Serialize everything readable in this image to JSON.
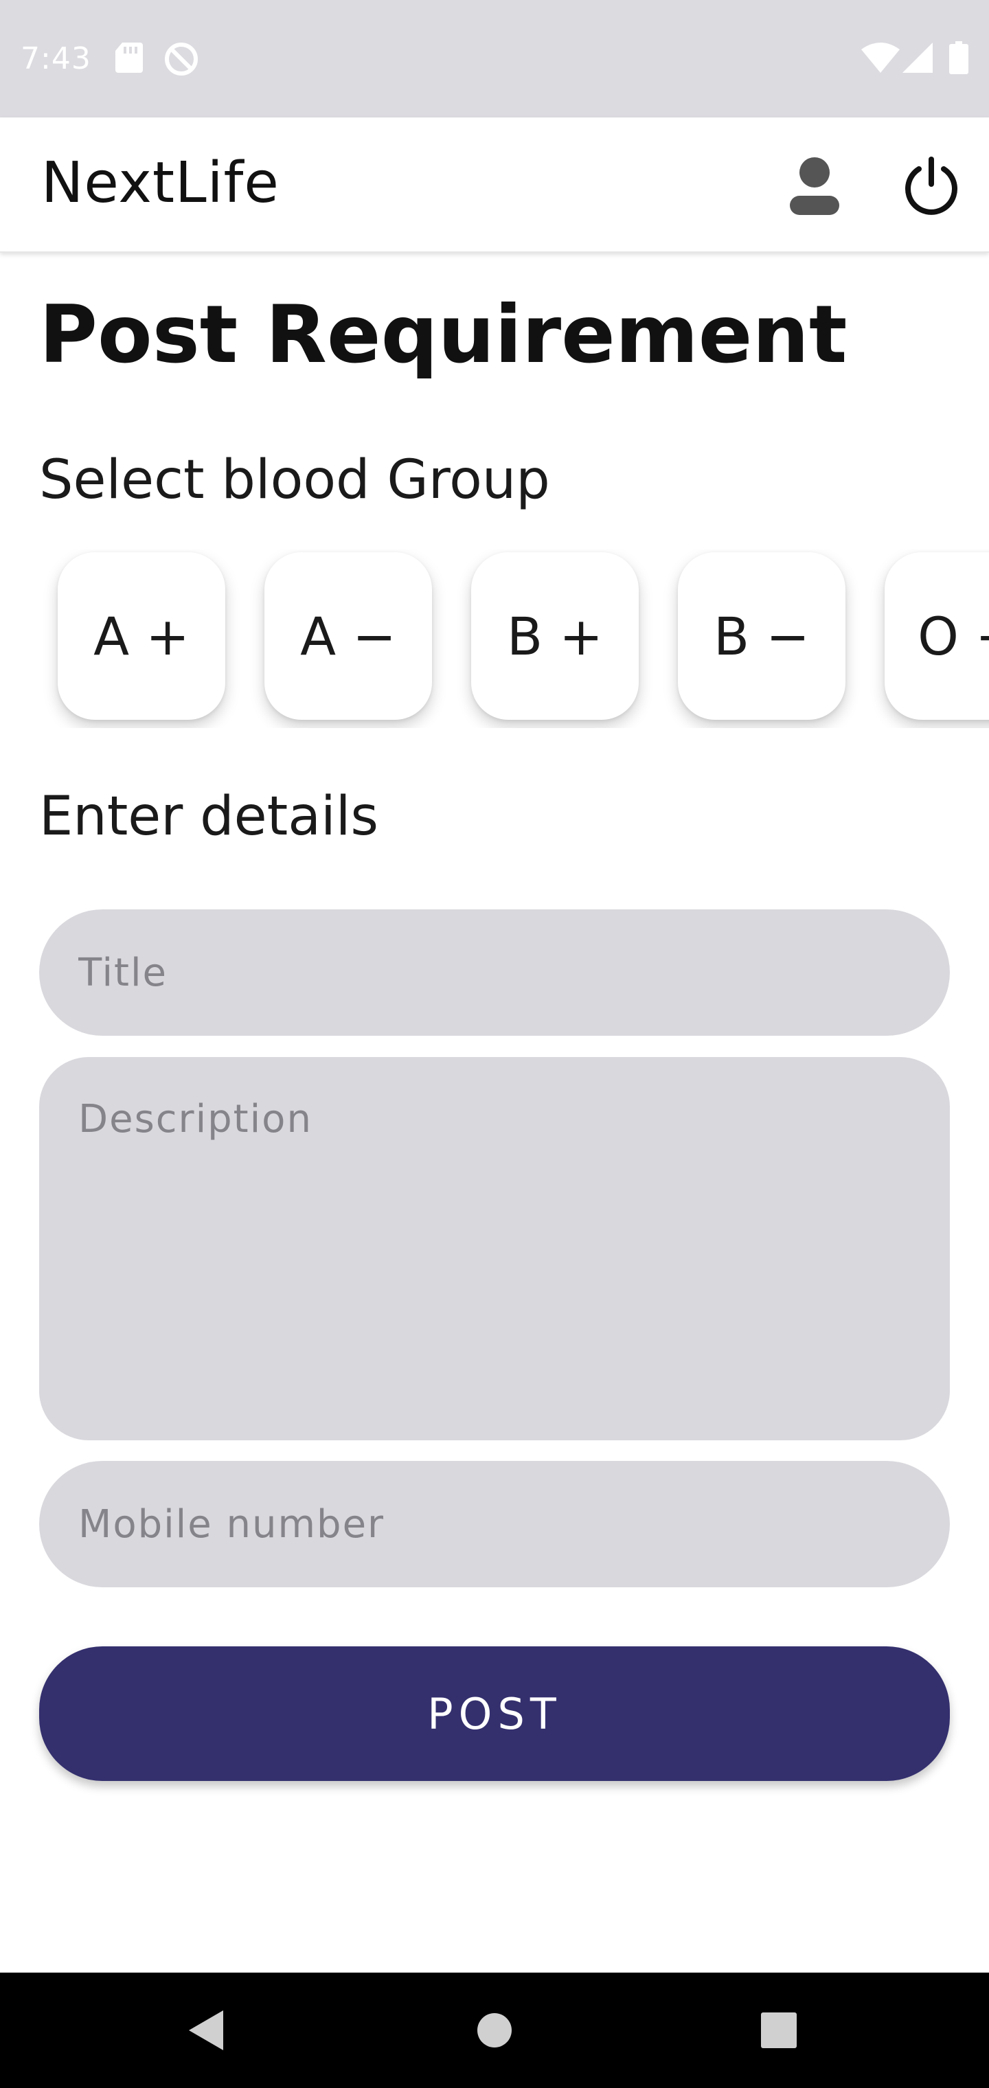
{
  "status_bar": {
    "time": "7:43",
    "icons_left": [
      "sd-card-icon",
      "do-not-disturb-icon"
    ],
    "icons_right": [
      "wifi-icon",
      "cellular-signal-icon",
      "battery-icon"
    ]
  },
  "app_bar": {
    "logo": "NextLife",
    "profile_icon": "person-icon",
    "logout_icon": "power-icon"
  },
  "page": {
    "title": "Post Requirement",
    "blood_group_label": "Select blood Group",
    "blood_groups": [
      "A +",
      "A −",
      "B +",
      "B −",
      "O +"
    ],
    "details_label": "Enter details"
  },
  "form": {
    "title_placeholder": "Title",
    "description_placeholder": "Description",
    "mobile_placeholder": "Mobile number",
    "post_label": "POST"
  },
  "colors": {
    "accent": "#34306e",
    "field_bg": "#d9d8dd",
    "status_bar_bg": "#dcdbe0"
  },
  "nav_bar": {
    "back_icon": "back-triangle-icon",
    "home_icon": "home-circle-icon",
    "recents_icon": "recents-square-icon"
  }
}
